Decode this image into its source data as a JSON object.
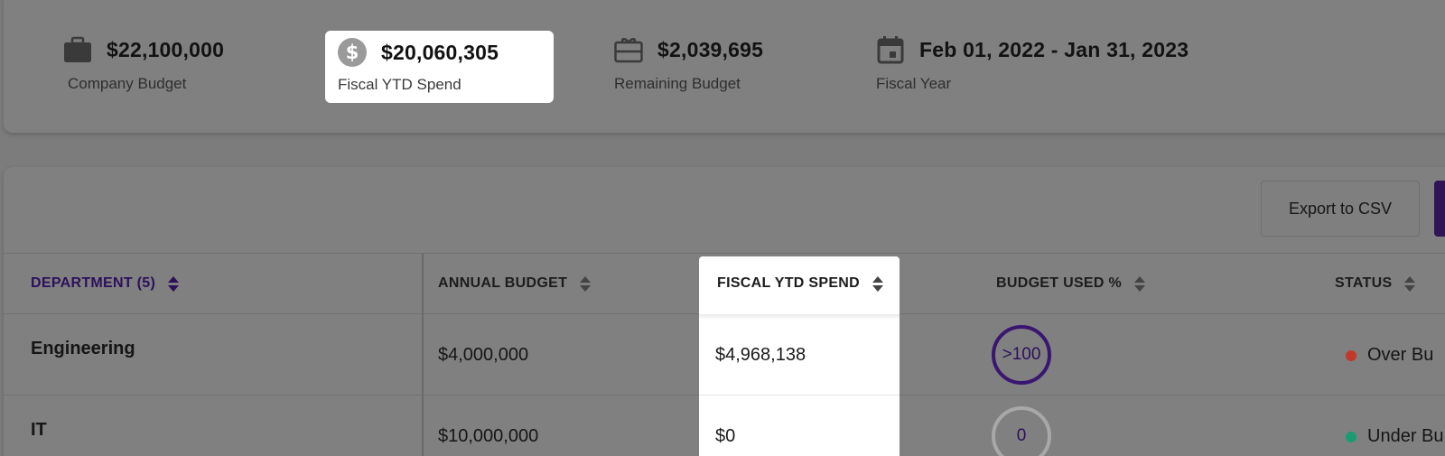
{
  "summary": {
    "company_budget": {
      "value": "$22,100,000",
      "label": "Company Budget",
      "icon": "briefcase-icon"
    },
    "fiscal_ytd_spend": {
      "value": "$20,060,305",
      "label": "Fiscal YTD Spend",
      "icon": "dollar-circle-icon"
    },
    "remaining_budget": {
      "value": "$2,039,695",
      "label": "Remaining Budget",
      "icon": "gift-card-icon"
    },
    "fiscal_year": {
      "value": "Feb 01, 2022 - Jan 31, 2023",
      "label": "Fiscal Year",
      "icon": "calendar-icon"
    }
  },
  "toolbar": {
    "export_label": "Export to CSV"
  },
  "table": {
    "columns": {
      "department": "DEPARTMENT (5)",
      "annual_budget": "ANNUAL BUDGET",
      "fiscal_ytd_spend": "FISCAL YTD SPEND",
      "budget_used": "BUDGET USED %",
      "status": "STATUS"
    },
    "rows": [
      {
        "department": "Engineering",
        "annual_budget": "$4,000,000",
        "fiscal_ytd_spend": "$4,968,138",
        "budget_used": ">100",
        "status": "Over Bu",
        "status_color": "#c0392b"
      },
      {
        "department": "IT",
        "annual_budget": "$10,000,000",
        "fiscal_ytd_spend": "$0",
        "budget_used": "0",
        "status": "Under Bu",
        "status_color": "#1a9b72"
      }
    ]
  },
  "colors": {
    "accent": "#2c0f5c",
    "over": "#c0392b",
    "under": "#1a9b72"
  }
}
